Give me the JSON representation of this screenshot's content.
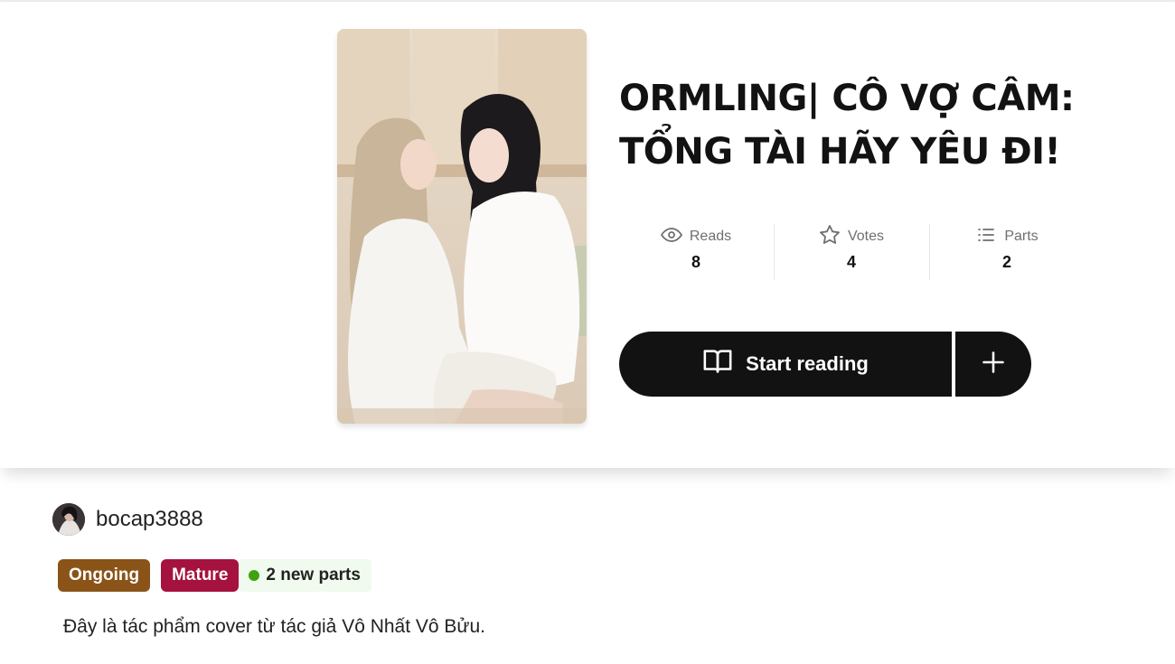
{
  "story": {
    "title_line1": "ORMLING| CÔ VỢ CÂM:",
    "title_line2": "TỔNG TÀI HÃY YÊU ĐI!",
    "description": "Đây là tác phẩm cover từ tác giả Vô Nhất Vô Bửu."
  },
  "stats": [
    {
      "label": "Reads",
      "value": "8",
      "icon": "eye-icon"
    },
    {
      "label": "Votes",
      "value": "4",
      "icon": "star-icon"
    },
    {
      "label": "Parts",
      "value": "2",
      "icon": "list-icon"
    }
  ],
  "actions": {
    "start_reading_label": "Start reading",
    "add_icon": "plus-icon",
    "read_icon": "open-book-icon"
  },
  "author": {
    "username": "bocap3888"
  },
  "tags": {
    "status": "Ongoing",
    "rating": "Mature",
    "new_parts": "2 new parts"
  },
  "colors": {
    "button_bg": "#121212",
    "ongoing": "#8a5418",
    "mature": "#a5123f",
    "new_dot": "#3ea20f",
    "new_bg": "#f1faee"
  }
}
